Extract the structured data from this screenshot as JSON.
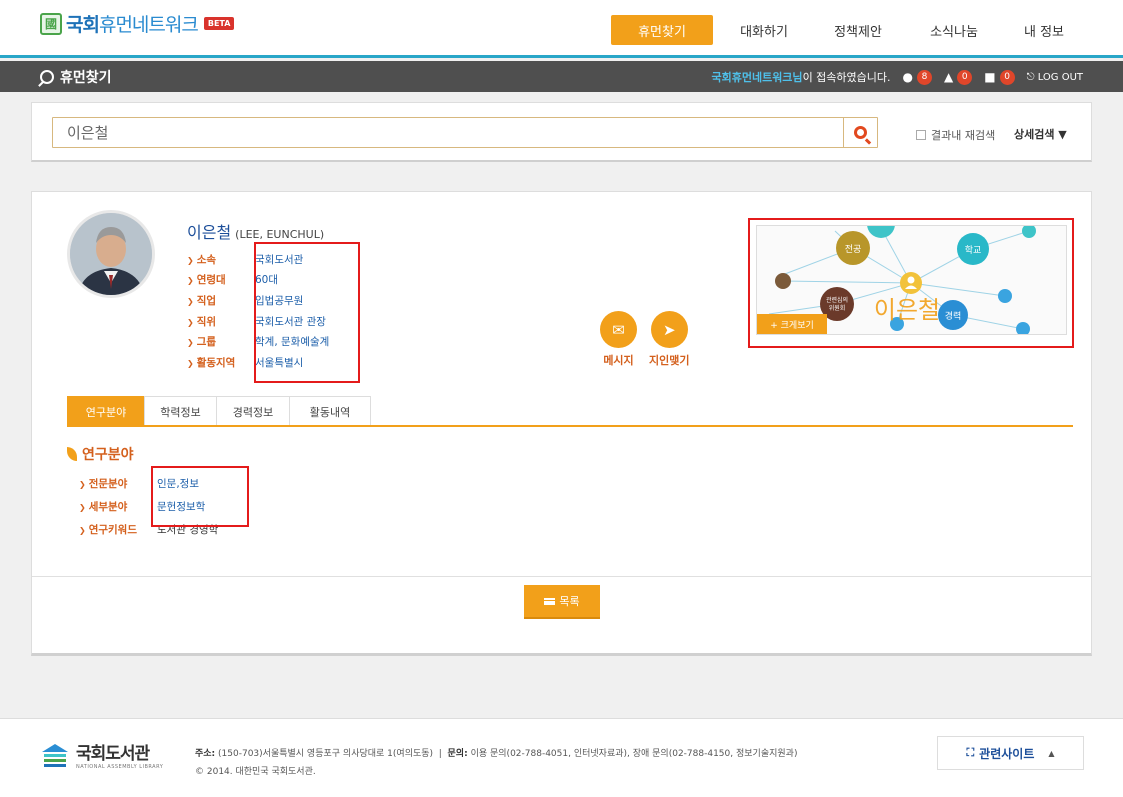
{
  "header": {
    "logo_mark": "國",
    "logo_main": "국회",
    "logo_rest": "휴먼네트워크",
    "beta": "BETA",
    "nav": [
      {
        "label": "휴먼찾기",
        "active": true
      },
      {
        "label": "대화하기",
        "active": false
      },
      {
        "label": "정책제안",
        "active": false
      },
      {
        "label": "소식나눔",
        "active": false
      },
      {
        "label": "내 정보",
        "active": false
      }
    ]
  },
  "subbar": {
    "title": "휴먼찾기",
    "user": "국회휴먼네트워크님",
    "connected": "이 접속하였습니다.",
    "counts": {
      "messages": "8",
      "alerts": "0",
      "friends": "0"
    },
    "logout": "LOG OUT"
  },
  "search": {
    "query": "이은철",
    "recheck_label": "결과내 재검색",
    "advanced_label": "상세검색 ▼"
  },
  "profile": {
    "name": "이은철",
    "name_en": "(LEE, EUNCHUL)",
    "fields": [
      {
        "label": "소속",
        "value": "국회도서관"
      },
      {
        "label": "연령대",
        "value": "60대"
      },
      {
        "label": "직업",
        "value": "입법공무원"
      },
      {
        "label": "직위",
        "value": "국회도서관 관장"
      },
      {
        "label": "그룹",
        "value": "학계, 문화예술계"
      },
      {
        "label": "활동지역",
        "value": "서울특별시"
      }
    ],
    "actions": {
      "message": "메시지",
      "connect": "지인맺기"
    },
    "network": {
      "center_name": "이은철",
      "expand": "+ 크게보기",
      "nodes": {
        "major": "전공",
        "school": "학교",
        "career": "경력",
        "committee_1": "관련심의",
        "committee_2": "위원회"
      }
    }
  },
  "tabs": [
    {
      "label": "연구분야",
      "active": true
    },
    {
      "label": "학력정보",
      "active": false
    },
    {
      "label": "경력정보",
      "active": false
    },
    {
      "label": "활동내역",
      "active": false
    }
  ],
  "research": {
    "title": "연구분야",
    "rows": [
      {
        "label": "전문분야",
        "value": "인문,정보"
      },
      {
        "label": "세부분야",
        "value": "문헌정보학"
      },
      {
        "label": "연구키워드",
        "value": "도서관 경영학"
      }
    ]
  },
  "list_button": "목록",
  "footer": {
    "logo": "국회도서관",
    "logo_en": "NATIONAL ASSEMBLY LIBRARY",
    "address_label": "주소:",
    "address": "(150-703)서울특별시 영등포구 의사당대로 1(여의도동)",
    "contact_label": "문의:",
    "contact": "이용 문의(02-788-4051, 인터넷자료과), 장애 문의(02-788-4150, 정보기술지원과)",
    "copyright": "© 2014. 대한민국 국회도서관.",
    "related": "관련사이트",
    "related_arrow": "▲"
  },
  "colors": {
    "accent": "#f2a01a",
    "link": "#1d5faa",
    "label": "#d4601d",
    "header_line": "#29a6c8",
    "highlight_box": "#e41b1b"
  }
}
